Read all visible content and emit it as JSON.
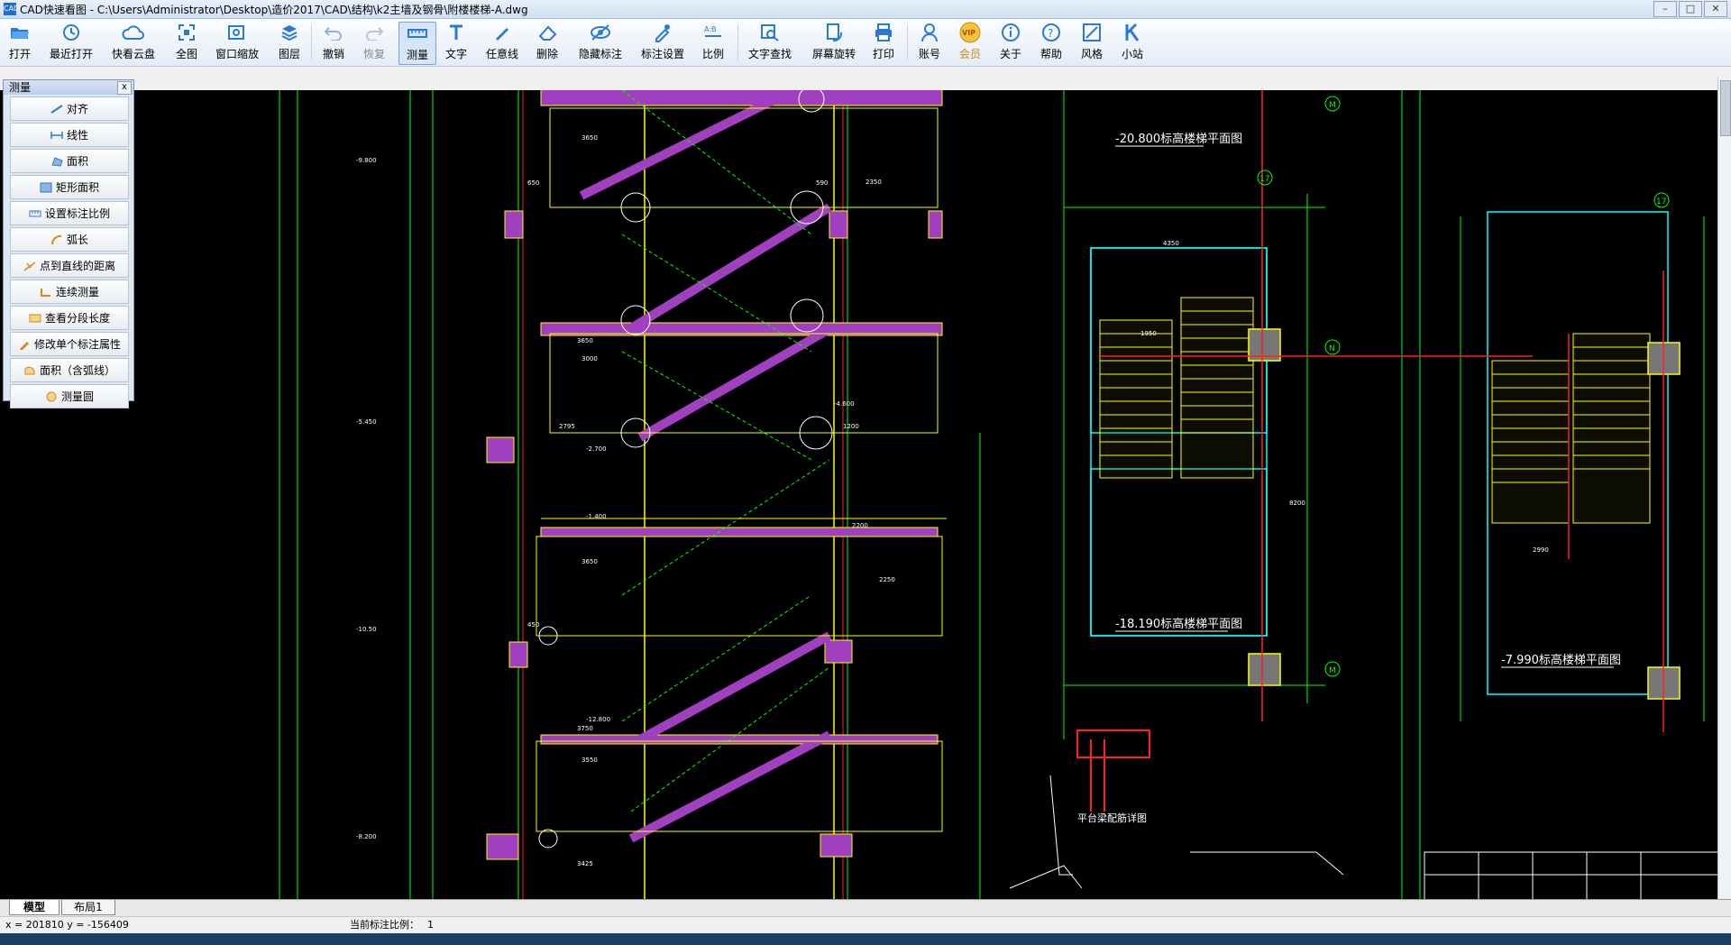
{
  "window": {
    "title": "CAD快速看图 - C:\\Users\\Administrator\\Desktop\\造价2017\\CAD\\结构\\k2主墙及钢骨\\附楼楼梯-A.dwg",
    "app_icon_text": "CAD"
  },
  "toolbar": {
    "items": [
      {
        "label": "打开",
        "icon": "folder-open-icon"
      },
      {
        "label": "最近打开",
        "icon": "history-icon"
      },
      {
        "label": "快看云盘",
        "icon": "cloud-icon"
      },
      {
        "label": "全图",
        "icon": "fit-view-icon"
      },
      {
        "label": "窗口缩放",
        "icon": "window-zoom-icon"
      },
      {
        "label": "图层",
        "icon": "layers-icon"
      },
      {
        "label": "撤销",
        "icon": "undo-icon"
      },
      {
        "label": "恢复",
        "icon": "redo-icon"
      },
      {
        "label": "测量",
        "icon": "measure-icon"
      },
      {
        "label": "文字",
        "icon": "text-icon"
      },
      {
        "label": "任意线",
        "icon": "pen-icon"
      },
      {
        "label": "删除",
        "icon": "eraser-icon"
      },
      {
        "label": "隐藏标注",
        "icon": "hide-annotation-icon"
      },
      {
        "label": "标注设置",
        "icon": "annotation-settings-icon"
      },
      {
        "label": "比例",
        "icon": "scale-icon"
      },
      {
        "label": "文字查找",
        "icon": "text-search-icon"
      },
      {
        "label": "屏幕旋转",
        "icon": "rotate-screen-icon"
      },
      {
        "label": "打印",
        "icon": "print-icon"
      },
      {
        "label": "账号",
        "icon": "account-icon"
      },
      {
        "label": "会员",
        "icon": "vip-icon"
      },
      {
        "label": "关于",
        "icon": "info-icon"
      },
      {
        "label": "帮助",
        "icon": "help-icon"
      },
      {
        "label": "风格",
        "icon": "style-icon"
      },
      {
        "label": "小站",
        "icon": "station-icon"
      }
    ],
    "active": "测量",
    "vip_badge": "VIP"
  },
  "measure_panel": {
    "title": "测量",
    "close": "x",
    "items": [
      {
        "label": "对齐",
        "icon": "aligned-dimension-icon"
      },
      {
        "label": "线性",
        "icon": "linear-dimension-icon"
      },
      {
        "label": "面积",
        "icon": "area-icon"
      },
      {
        "label": "矩形面积",
        "icon": "rect-area-icon"
      },
      {
        "label": "设置标注比例",
        "icon": "set-scale-icon"
      },
      {
        "label": "弧长",
        "icon": "arc-length-icon"
      },
      {
        "label": "点到直线的距离",
        "icon": "point-line-distance-icon"
      },
      {
        "label": "连续测量",
        "icon": "continuous-measure-icon"
      },
      {
        "label": "查看分段长度",
        "icon": "segment-length-icon"
      },
      {
        "label": "修改单个标注属性",
        "icon": "edit-annotation-icon"
      },
      {
        "label": "面积（含弧线）",
        "icon": "area-arc-icon"
      },
      {
        "label": "测量圆",
        "icon": "measure-circle-icon"
      }
    ]
  },
  "drawing": {
    "plan_titles": [
      "-20.800标高楼梯平面图",
      "-18.190标高楼梯平面图",
      "-7.990标高楼梯平面图",
      "平台梁配筋详图"
    ],
    "grid_bubbles": [
      "M",
      "N",
      "M",
      "17",
      "17"
    ],
    "elevations": [
      "-9.800",
      "-5.450",
      "-10.50",
      "-8.200",
      "-2.700",
      "-4.600",
      "-1.400",
      "-12.800"
    ],
    "dims": [
      "4350",
      "2350",
      "3650",
      "2200",
      "3000",
      "1950",
      "2990",
      "8200",
      "3750",
      "450",
      "3550",
      "2250",
      "650",
      "590",
      "1200",
      "2795",
      "3650",
      "3425",
      "3650"
    ]
  },
  "colors": {
    "stair_fill": "#a040c0",
    "line_green": "#00ff00",
    "line_yellow": "#ffff00",
    "line_cyan": "#00ffff",
    "line_red": "#ff2020",
    "canvas_bg": "#000000",
    "toolbar_icon": "#2a7ad5"
  },
  "tabs": {
    "items": [
      "模型",
      "布局1"
    ],
    "active": "模型"
  },
  "status": {
    "coords": "x = 201810  y = -156409",
    "scale_label": "当前标注比例：",
    "scale_value": "1"
  }
}
